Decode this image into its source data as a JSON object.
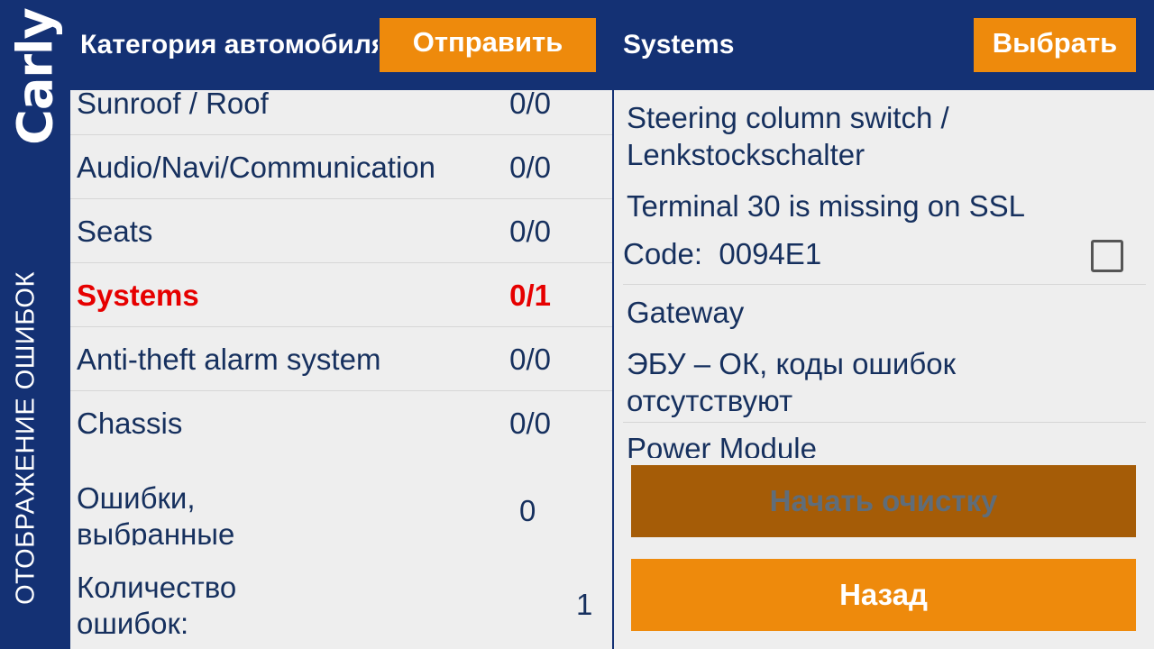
{
  "brand": "Carly",
  "sidebar_title": "ОТОБРАЖЕНИЕ ОШИБОК",
  "header": {
    "left_title": "Категория автомобиля",
    "send_label": "Отправить",
    "right_title": "Systems",
    "choose_label": "Выбрать"
  },
  "categories": [
    {
      "name": "Sunroof / Roof",
      "count": "0/0"
    },
    {
      "name": "Audio/Navi/Communication",
      "count": "0/0"
    },
    {
      "name": "Seats",
      "count": "0/0"
    },
    {
      "name": "Systems",
      "count": "0/1",
      "active": true
    },
    {
      "name": "Anti-theft alarm system",
      "count": "0/0"
    },
    {
      "name": "Chassis",
      "count": "0/0"
    }
  ],
  "stats": {
    "selected_label_1": "Ошибки,",
    "selected_label_2": "выбранные",
    "selected_value": "0",
    "count_label_1": "Количество",
    "count_label_2": "ошибок:",
    "count_value": "1"
  },
  "errors": {
    "item1_name_1": "Steering column switch /",
    "item1_name_2": "Lenkstockschalter",
    "item1_desc": "Terminal 30 is missing on SSL",
    "item1_code": "Code:  0094E1",
    "item1_checked": false,
    "item2_name": "Gateway",
    "item2_desc_1": "ЭБУ – ОК, коды ошибок",
    "item2_desc_2": "отсутствуют",
    "item3_name": "Power Module"
  },
  "buttons": {
    "clear_label": "Начать очистку",
    "back_label": "Назад"
  },
  "colors": {
    "brand_blue": "#143174",
    "accent_orange": "#ee8a0c",
    "disabled_orange": "#a55c07",
    "active_red": "#e60000",
    "text_navy": "#16305e"
  }
}
